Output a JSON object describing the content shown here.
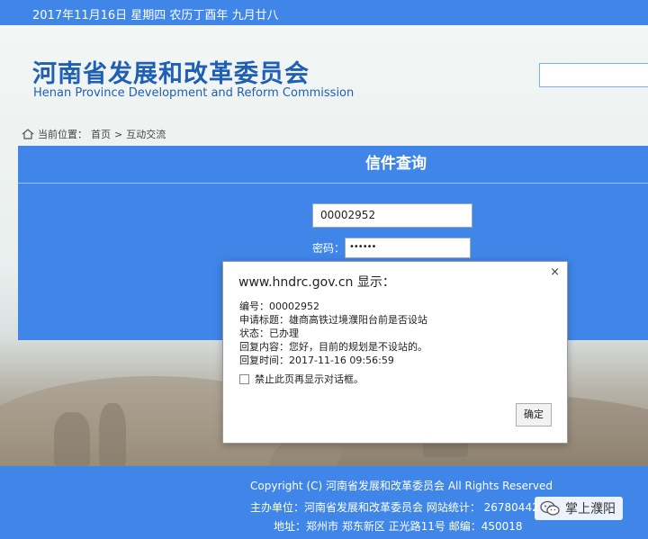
{
  "topbar": {
    "date": "2017年11月16日 星期四 农历丁酉年 九月廿八"
  },
  "header": {
    "title_cn": "河南省发展和改革委员会",
    "title_en": "Henan Province Development and Reform Commission"
  },
  "breadcrumb": {
    "label": "当前位置：",
    "home": "首页",
    "separator": ">",
    "current": "互动交流"
  },
  "panel": {
    "title": "信件查询",
    "number_value": "00002952",
    "password_label": "密码：",
    "password_value": "••••••"
  },
  "dialog": {
    "header": "www.hndrc.gov.cn 显示：",
    "close": "×",
    "lines": [
      "编号：00002952",
      "申请标题：雄商高铁过境濮阳台前是否设站",
      "状态：已办理",
      "回复内容：您好，目前的规划是不设站的。",
      "回复时间：2017-11-16 09:56:59"
    ],
    "checkbox_label": "禁止此页再显示对话框。",
    "ok_label": "确定"
  },
  "footer": {
    "copyright": "Copyright (C) 河南省发展和改革委员会 All Rights Reserved",
    "sponsor": "主办单位：河南省发展和改革委员会 网站统计： 26780442",
    "address": "地址：郑州市 郑东新区 正光路11号 邮编：450018"
  },
  "watermark": {
    "label": "掌上濮阳"
  },
  "colors": {
    "accent": "#3f86e8",
    "title": "#1f5fb5"
  }
}
